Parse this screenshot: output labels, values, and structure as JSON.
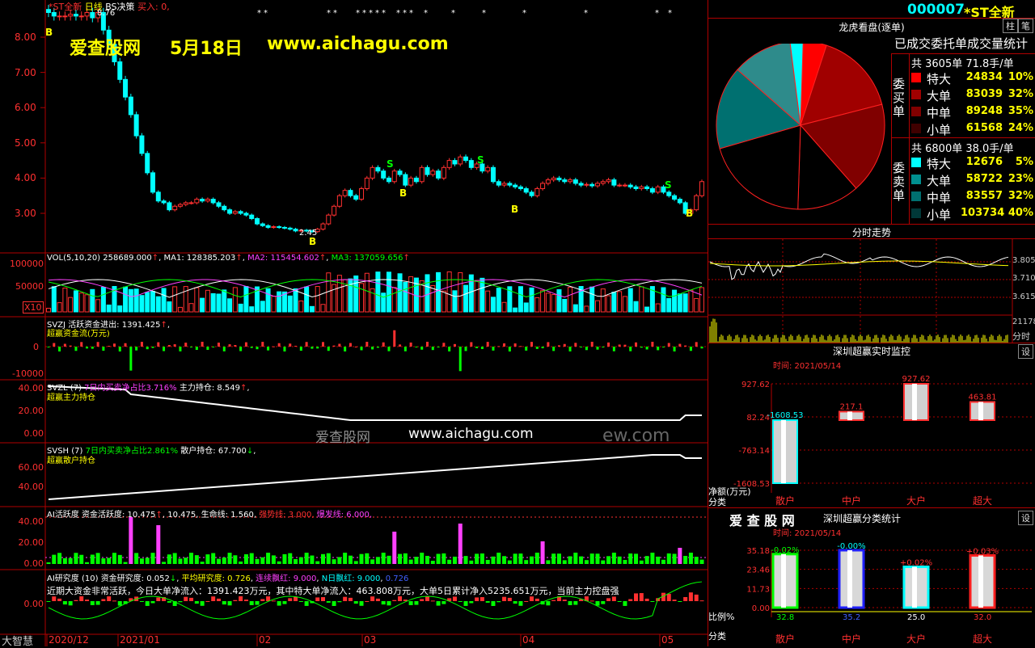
{
  "header": {
    "code": "000007",
    "name": "*ST全新",
    "btn_zhu": "柱",
    "btn_bi": "笔",
    "chart_title": "*ST全新",
    "period": "日线",
    "bs_label": "BS决策",
    "buy_label": "买入: 0,"
  },
  "watermark": {
    "site": "爱查股网",
    "date": "5月18日",
    "url": "www.aichagu.com",
    "center": "爱查股网",
    "center_url": "www.aichagu.com",
    "faded": "ew.com"
  },
  "price_chart": {
    "y_ticks": [
      "8.00",
      "7.00",
      "6.00",
      "5.00",
      "4.00",
      "3.00"
    ],
    "low_label": "2.45",
    "high_label": "8.76",
    "x_labels": [
      "2020/12",
      "2021/01",
      "02",
      "03",
      "04",
      "05"
    ],
    "candles": [
      8.7,
      8.6,
      8.6,
      8.6,
      8.65,
      8.6,
      8.6,
      8.7,
      8.55,
      8.7,
      8.2,
      7.8,
      7.3,
      6.8,
      6.3,
      5.8,
      5.2,
      4.7,
      4.15,
      3.6,
      3.35,
      3.3,
      3.1,
      3.2,
      3.25,
      3.3,
      3.3,
      3.4,
      3.35,
      3.4,
      3.3,
      3.2,
      3.1,
      3.0,
      3.05,
      3.0,
      2.95,
      2.85,
      2.7,
      2.65,
      2.6,
      2.62,
      2.6,
      2.58,
      2.55,
      2.5,
      2.52,
      2.5,
      2.48,
      2.55,
      2.7,
      2.95,
      3.2,
      3.5,
      3.65,
      3.5,
      3.4,
      3.7,
      4.0,
      4.3,
      4.2,
      4.0,
      3.9,
      4.2,
      4.1,
      3.8,
      4.0,
      3.9,
      4.3,
      4.1,
      4.2,
      4.0,
      4.3,
      4.5,
      4.4,
      4.6,
      4.5,
      4.3,
      4.4,
      4.2,
      4.3,
      3.9,
      3.8,
      3.85,
      3.8,
      3.75,
      3.7,
      3.6,
      3.5,
      3.7,
      3.85,
      3.95,
      4.0,
      3.95,
      3.9,
      3.95,
      3.85,
      3.8,
      3.82,
      3.78,
      3.85,
      3.9,
      3.95,
      3.8,
      3.8,
      3.8,
      3.75,
      3.7,
      3.75,
      3.7,
      3.6,
      3.75,
      3.6,
      3.5,
      3.4,
      3.3,
      3.0,
      3.1,
      3.5,
      3.9
    ]
  },
  "vol_panel": {
    "label": "VOL(5,10,20)",
    "val": "258689.000",
    "ma1": "MA1: 128385.203",
    "ma2": "MA2: 115454.602",
    "ma3": "MA3: 137059.656",
    "ticks": [
      "100000",
      "50000"
    ],
    "x10": "X10"
  },
  "svzj_panel": {
    "label": "SVZJ",
    "text": "活跃资金进出: 1391.425",
    "sub": "超赢资金流(万元)",
    "ticks": [
      "0",
      "-10000"
    ]
  },
  "svzl_panel": {
    "label": "SVZL (7)",
    "text1": "7日内买卖净占比3.716%",
    "text2": "主力持仓: 8.549",
    "sub": "超赢主力持仓",
    "ticks": [
      "40.00",
      "20.00",
      "0.00"
    ]
  },
  "svsh_panel": {
    "label": "SVSH (7)",
    "text1": "7日内买卖净占比2.861%",
    "text2": "散户持仓: 67.700",
    "sub": "超赢散户持仓",
    "ticks": [
      "60.00",
      "40.00"
    ]
  },
  "ai_active_panel": {
    "label": "AI活跃度",
    "text": "资金活跃度: 10.475",
    "val2": "10.475,",
    "life": "生命线: 1.560,",
    "strong": "强势线: 3.000,",
    "burst": "爆发线: 6.000,",
    "ticks": [
      "40.00",
      "20.00",
      "0.00"
    ]
  },
  "ai_research_panel": {
    "label": "AI研究度 (10)",
    "text": "资金研究度: 0.052",
    "flat": "平均研究度: 0.726",
    "cont": "连续飘红: 9.000",
    "n_red": "N日飘红: 9.000",
    "last": "0.726",
    "ticks": [
      "0.00"
    ],
    "desc": "近期大资金非常活跃，今日大单净流入：1391.423万元，其中特大单净流入：463.808万元，大单5日累计净入5235.651万元，当前主力控盘强"
  },
  "bottom_left": "大智慧",
  "dragon_tiger": {
    "title": "龙虎看盘(逐单)",
    "subtitle": "已成交委托单成交量统计",
    "buy_side_label": "委买单",
    "sell_side_label": "委卖单",
    "buy_total": "共 3605单 71.8手/单",
    "sell_total": "共 6800单 38.0手/单",
    "buy_rows": [
      {
        "name": "特大",
        "val": "24834",
        "pct": "10%",
        "color": "#ff0000"
      },
      {
        "name": "大单",
        "val": "83039",
        "pct": "32%",
        "color": "#a00000"
      },
      {
        "name": "中单",
        "val": "89248",
        "pct": "35%",
        "color": "#800000"
      },
      {
        "name": "小单",
        "val": "61568",
        "pct": "24%",
        "color": "#400000"
      }
    ],
    "sell_rows": [
      {
        "name": "特大",
        "val": "12676",
        "pct": "5%",
        "color": "#00ffff"
      },
      {
        "name": "大单",
        "val": "58722",
        "pct": "23%",
        "color": "#009090"
      },
      {
        "name": "中单",
        "val": "83557",
        "pct": "32%",
        "color": "#007070"
      },
      {
        "name": "小单",
        "val": "103734",
        "pct": "40%",
        "color": "#003838"
      }
    ]
  },
  "intraday": {
    "title": "分时走势",
    "ticks": [
      "3.805",
      "3.710",
      "3.615"
    ],
    "vol_val": "21178",
    "vol_unit": "分时"
  },
  "realtime_monitor": {
    "title": "深圳超赢实时监控",
    "btn": "设",
    "time": "时间: 2021/05/14",
    "y_ticks": [
      "927.62",
      "82.24",
      "-763.14",
      "-1608.53"
    ],
    "y_unit": "净额(万元)",
    "x_unit": "分类",
    "categories": [
      "散户",
      "中户",
      "大户",
      "超大"
    ],
    "chart_data": {
      "type": "bar",
      "categories": [
        "散户",
        "中户",
        "大户",
        "超大"
      ],
      "values": [
        -1608.53,
        217.1,
        927.62,
        463.81
      ],
      "ylim": [
        -1608.53,
        927.62
      ]
    },
    "labels": [
      "-1608.53",
      "217.1",
      "927.62",
      "463.81"
    ]
  },
  "class_stats": {
    "logo": "爱 查 股 网",
    "title": "深圳超赢分类统计",
    "btn": "设",
    "time": "时间: 2021/05/14",
    "y_ticks": [
      "35.18",
      "23.46",
      "11.73",
      "0.00"
    ],
    "y_unit": "比例%",
    "x_unit": "分类",
    "categories": [
      "散户",
      "中户",
      "大户",
      "超大"
    ],
    "chart_data": {
      "type": "bar",
      "categories": [
        "散户",
        "中户",
        "大户",
        "超大"
      ],
      "values": [
        32.8,
        35.2,
        25.0,
        32.0
      ],
      "ylim": [
        0,
        35.18
      ]
    },
    "top_labels": [
      "-0.02%",
      "-0.00%",
      "+0.02%",
      "+0.03%"
    ],
    "bottom_labels": [
      "32.8",
      "35.2",
      "25.0",
      "32.0"
    ]
  }
}
